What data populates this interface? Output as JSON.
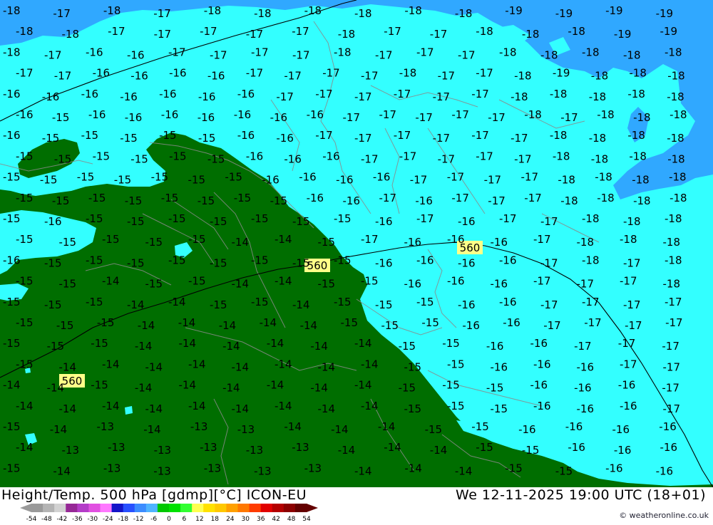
{
  "title": "Height/Temp. 500 hPa [gdmp][°C] ICON-EU",
  "time": "We 12-11-2025 19:00 UTC (18+01)",
  "credit": "© weatheronline.co.uk",
  "scale_ticks": [
    "-54",
    "-48",
    "-42",
    "-36",
    "-30",
    "-24",
    "-18",
    "-12",
    "-6",
    "0",
    "6",
    "12",
    "18",
    "24",
    "30",
    "36",
    "42",
    "48",
    "54"
  ],
  "scale_colors": [
    "#9a9a9a",
    "#b4b4b4",
    "#d2d2d2",
    "#962896",
    "#b43cc8",
    "#e150e1",
    "#ff78ff",
    "#1414c8",
    "#2850ff",
    "#3c8cff",
    "#50b4ff",
    "#00c800",
    "#00e100",
    "#32ff32",
    "#ffff50",
    "#ffe100",
    "#ffc800",
    "#ffa000",
    "#ff7800",
    "#ff3c00",
    "#e10000",
    "#b40000",
    "#8c0000",
    "#640000"
  ],
  "colors": {
    "green": "#006e00",
    "cyan": "#33ffff",
    "blue": "#30a8ff",
    "line": "#000000"
  },
  "contour_labels": [
    "560",
    "560",
    "560"
  ],
  "temps": [
    [
      "-18",
      "-17",
      "-18",
      "-17",
      "-18",
      "-18",
      "-18",
      "-18",
      "-18",
      "-18",
      "-19",
      "-19",
      "-19",
      "-19"
    ],
    [
      "-18",
      "-18",
      "-17",
      "-17",
      "-17",
      "-17",
      "-17",
      "-18",
      "-17",
      "-17",
      "-18",
      "-18",
      "-18",
      "-19",
      "-19"
    ],
    [
      "-18",
      "-17",
      "-16",
      "-16",
      "-17",
      "-17",
      "-17",
      "-17",
      "-18",
      "-17",
      "-17",
      "-17",
      "-18",
      "-18",
      "-18",
      "-18",
      "-18"
    ],
    [
      "-17",
      "-17",
      "-16",
      "-16",
      "-16",
      "-16",
      "-17",
      "-17",
      "-17",
      "-17",
      "-18",
      "-17",
      "-17",
      "-18",
      "-19",
      "-18",
      "-18",
      "-18"
    ],
    [
      "-16",
      "-16",
      "-16",
      "-16",
      "-16",
      "-16",
      "-16",
      "-17",
      "-17",
      "-17",
      "-17",
      "-17",
      "-17",
      "-18",
      "-18",
      "-18",
      "-18",
      "-18"
    ],
    [
      "-16",
      "-15",
      "-16",
      "-16",
      "-16",
      "-16",
      "-16",
      "-16",
      "-16",
      "-17",
      "-17",
      "-17",
      "-17",
      "-17",
      "-18",
      "-17",
      "-18",
      "-18",
      "-18"
    ],
    [
      "-16",
      "-15",
      "-15",
      "-15",
      "-15",
      "-15",
      "-16",
      "-16",
      "-17",
      "-17",
      "-17",
      "-17",
      "-17",
      "-17",
      "-18",
      "-18",
      "-18",
      "-18"
    ],
    [
      "-15",
      "-15",
      "-15",
      "-15",
      "-15",
      "-15",
      "-16",
      "-16",
      "-16",
      "-17",
      "-17",
      "-17",
      "-17",
      "-17",
      "-18",
      "-18",
      "-18",
      "-18"
    ],
    [
      "-15",
      "-15",
      "-15",
      "-15",
      "-15",
      "-15",
      "-15",
      "-16",
      "-16",
      "-16",
      "-16",
      "-17",
      "-17",
      "-17",
      "-17",
      "-18",
      "-18",
      "-18",
      "-18"
    ],
    [
      "-15",
      "-15",
      "-15",
      "-15",
      "-15",
      "-15",
      "-15",
      "-15",
      "-16",
      "-16",
      "-17",
      "-16",
      "-17",
      "-17",
      "-17",
      "-18",
      "-18",
      "-18",
      "-18"
    ],
    [
      "-15",
      "-16",
      "-15",
      "-15",
      "-15",
      "-15",
      "-15",
      "-15",
      "-15",
      "-16",
      "-17",
      "-16",
      "-17",
      "-17",
      "-18",
      "-18",
      "-18"
    ],
    [
      "-15",
      "-15",
      "-15",
      "-15",
      "-15",
      "-14",
      "-14",
      "-15",
      "-17",
      "-16",
      "-16",
      "-16",
      "-17",
      "-18",
      "-18",
      "-18"
    ],
    [
      "-16",
      "-15",
      "-15",
      "-15",
      "-15",
      "-15",
      "-15",
      "-15",
      "-15",
      "-16",
      "-16",
      "-16",
      "-16",
      "-17",
      "-18",
      "-17",
      "-18"
    ],
    [
      "-15",
      "-15",
      "-14",
      "-15",
      "-15",
      "-14",
      "-14",
      "-15",
      "-15",
      "-16",
      "-16",
      "-16",
      "-17",
      "-17",
      "-17",
      "-18"
    ],
    [
      "-15",
      "-15",
      "-15",
      "-14",
      "-14",
      "-15",
      "-15",
      "-14",
      "-15",
      "-15",
      "-15",
      "-16",
      "-16",
      "-17",
      "-17",
      "-17",
      "-17"
    ],
    [
      "-15",
      "-15",
      "-15",
      "-14",
      "-14",
      "-14",
      "-14",
      "-14",
      "-15",
      "-15",
      "-15",
      "-16",
      "-16",
      "-17",
      "-17",
      "-17",
      "-17"
    ],
    [
      "-15",
      "-15",
      "-15",
      "-14",
      "-14",
      "-14",
      "-14",
      "-14",
      "-14",
      "-15",
      "-15",
      "-16",
      "-16",
      "-17",
      "-17",
      "-17"
    ],
    [
      "-15",
      "-14",
      "-14",
      "-14",
      "-14",
      "-14",
      "-14",
      "-14",
      "-14",
      "-15",
      "-15",
      "-16",
      "-16",
      "-16",
      "-17",
      "-17"
    ],
    [
      "-14",
      "-14",
      "-15",
      "-14",
      "-14",
      "-14",
      "-14",
      "-14",
      "-14",
      "-15",
      "-15",
      "-15",
      "-16",
      "-16",
      "-16",
      "-17"
    ],
    [
      "-14",
      "-14",
      "-14",
      "-14",
      "-14",
      "-14",
      "-14",
      "-14",
      "-14",
      "-15",
      "-15",
      "-15",
      "-16",
      "-16",
      "-16",
      "-17"
    ],
    [
      "-15",
      "-14",
      "-13",
      "-14",
      "-13",
      "-13",
      "-14",
      "-14",
      "-14",
      "-15",
      "-15",
      "-16",
      "-16",
      "-16",
      "-16"
    ],
    [
      "-14",
      "-13",
      "-13",
      "-13",
      "-13",
      "-13",
      "-13",
      "-14",
      "-14",
      "-14",
      "-15",
      "-15",
      "-16",
      "-16",
      "-16"
    ],
    [
      "-15",
      "-14",
      "-13",
      "-13",
      "-13",
      "-13",
      "-13",
      "-14",
      "-14",
      "-14",
      "-15",
      "-15",
      "-16",
      "-16"
    ]
  ]
}
